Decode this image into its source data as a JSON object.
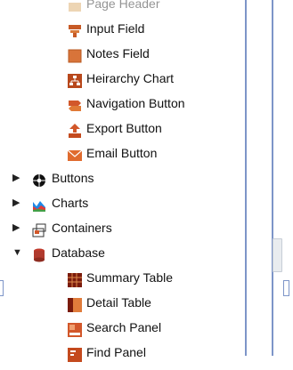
{
  "tree": {
    "cut_top_label": "Page Header",
    "fields": [
      {
        "label": "Input Field",
        "icon": "input-field-icon"
      },
      {
        "label": "Notes Field",
        "icon": "notes-field-icon"
      },
      {
        "label": "Heirarchy Chart",
        "icon": "hierarchy-chart-icon"
      },
      {
        "label": "Navigation Button",
        "icon": "navigation-button-icon"
      },
      {
        "label": "Export Button",
        "icon": "export-button-icon"
      },
      {
        "label": "Email Button",
        "icon": "email-button-icon"
      }
    ],
    "groups": [
      {
        "label": "Buttons",
        "icon": "buttons-group-icon",
        "expanded": false
      },
      {
        "label": "Charts",
        "icon": "charts-group-icon",
        "expanded": false
      },
      {
        "label": "Containers",
        "icon": "containers-group-icon",
        "expanded": false
      },
      {
        "label": "Database",
        "icon": "database-group-icon",
        "expanded": true
      }
    ],
    "database_items": [
      {
        "label": "Summary Table",
        "icon": "summary-table-icon"
      },
      {
        "label": "Detail Table",
        "icon": "detail-table-icon"
      },
      {
        "label": "Search Panel",
        "icon": "search-panel-icon"
      },
      {
        "label": "Find Panel",
        "icon": "find-panel-icon"
      }
    ],
    "toggle_glyphs": {
      "collapsed": "▶",
      "expanded": "▼"
    }
  }
}
